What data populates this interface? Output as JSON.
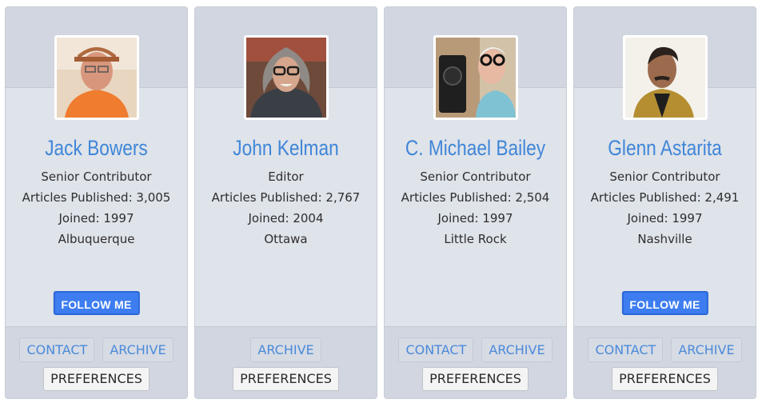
{
  "contributors": [
    {
      "name": "Jack Bowers",
      "role": "Senior Contributor",
      "articles": "Articles Published: 3,005",
      "joined": "Joined: 1997",
      "city": "Albuquerque",
      "follow_label": "FOLLOW ME",
      "contact_label": "CONTACT",
      "archive_label": "ARCHIVE",
      "preferences_label": "PREFERENCES"
    },
    {
      "name": "John Kelman",
      "role": "Editor",
      "articles": "Articles Published: 2,767",
      "joined": "Joined: 2004",
      "city": "Ottawa",
      "archive_label": "ARCHIVE",
      "preferences_label": "PREFERENCES"
    },
    {
      "name": "C. Michael Bailey",
      "role": "Senior Contributor",
      "articles": "Articles Published: 2,504",
      "joined": "Joined: 1997",
      "city": "Little Rock",
      "contact_label": "CONTACT",
      "archive_label": "ARCHIVE",
      "preferences_label": "PREFERENCES"
    },
    {
      "name": "Glenn Astarita",
      "role": "Senior Contributor",
      "articles": "Articles Published: 2,491",
      "joined": "Joined: 1997",
      "city": "Nashville",
      "follow_label": "FOLLOW ME",
      "contact_label": "CONTACT",
      "archive_label": "ARCHIVE",
      "preferences_label": "PREFERENCES"
    }
  ],
  "colors": {
    "accent": "#3f86d8",
    "follow_button": "#3d7df0",
    "card_body": "#dfe3ea",
    "card_band": "#d1d6e0"
  }
}
